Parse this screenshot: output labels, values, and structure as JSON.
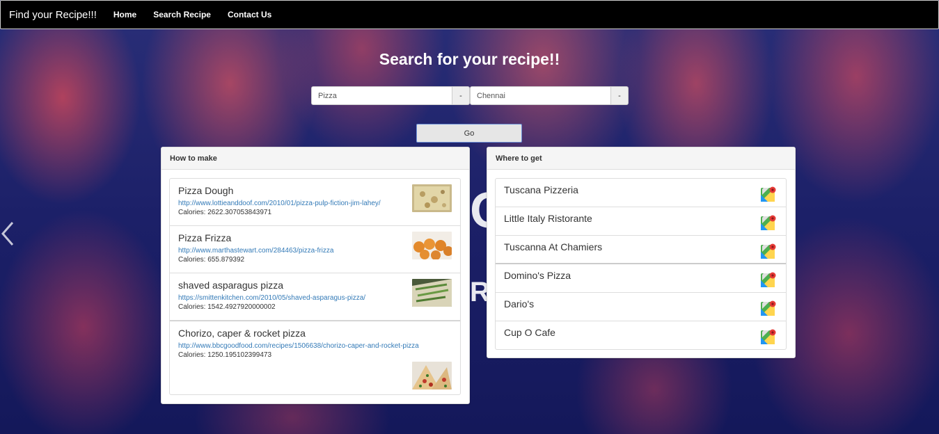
{
  "navbar": {
    "brand": "Find your Recipe!!!",
    "links": [
      "Home",
      "Search Recipe",
      "Contact Us"
    ]
  },
  "hero": {
    "title": "Search for your recipe!!"
  },
  "search": {
    "recipe_value": "Pizza",
    "recipe_addon": "-",
    "city_value": "Chennai",
    "city_addon": "-",
    "go_label": "Go"
  },
  "how_to_make": {
    "heading": "How to make",
    "recipes": [
      {
        "name": "Pizza Dough",
        "url": "http://www.lottieanddoof.com/2010/01/pizza-pulp-fiction-jim-lahey/",
        "calories": "Calories: 2622.307053843971"
      },
      {
        "name": "Pizza Frizza",
        "url": "http://www.marthastewart.com/284463/pizza-frizza",
        "calories": "Calories: 655.879392"
      },
      {
        "name": "shaved asparagus pizza",
        "url": "https://smittenkitchen.com/2010/05/shaved-asparagus-pizza/",
        "calories": "Calories: 1542.4927920000002"
      },
      {
        "name": "Chorizo, caper & rocket pizza",
        "url": "http://www.bbcgoodfood.com/recipes/1506638/chorizo-caper-and-rocket-pizza",
        "calories": "Calories: 1250.195102399473"
      }
    ]
  },
  "where_to_get": {
    "heading": "Where to get",
    "places": [
      "Tuscana Pizzeria",
      "Little Italy Ristorante",
      "Tuscanna At Chamiers",
      "Domino's Pizza",
      "Dario's",
      "Cup O Cafe"
    ]
  }
}
